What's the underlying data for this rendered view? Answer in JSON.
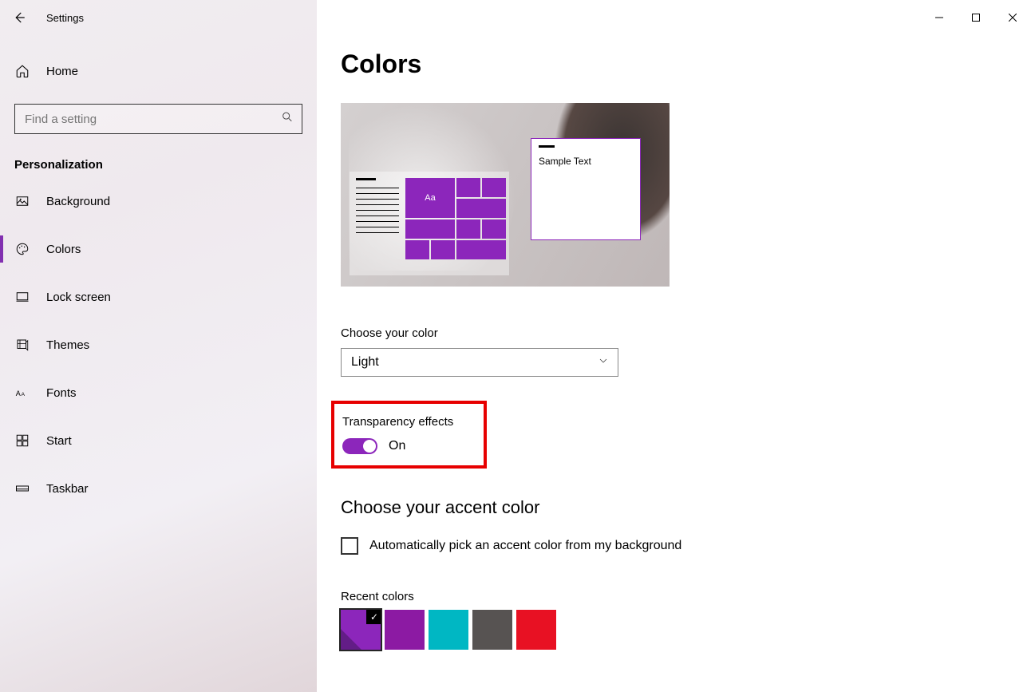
{
  "app": {
    "title": "Settings"
  },
  "sidebar": {
    "home": "Home",
    "search_placeholder": "Find a setting",
    "section": "Personalization",
    "items": [
      {
        "label": "Background"
      },
      {
        "label": "Colors"
      },
      {
        "label": "Lock screen"
      },
      {
        "label": "Themes"
      },
      {
        "label": "Fonts"
      },
      {
        "label": "Start"
      },
      {
        "label": "Taskbar"
      }
    ]
  },
  "main": {
    "title": "Colors",
    "preview": {
      "sample_text": "Sample Text",
      "tile_label": "Aa"
    },
    "choose_color": {
      "label": "Choose your color",
      "value": "Light"
    },
    "transparency": {
      "label": "Transparency effects",
      "state": "On"
    },
    "accent": {
      "heading": "Choose your accent color",
      "auto_label": "Automatically pick an accent color from my background",
      "recent_label": "Recent colors",
      "recent": [
        {
          "hex": "#8c26bb",
          "selected": true
        },
        {
          "hex": "#8c1aa3",
          "selected": false
        },
        {
          "hex": "#00b7c3",
          "selected": false
        },
        {
          "hex": "#575352",
          "selected": false
        },
        {
          "hex": "#e81123",
          "selected": false
        }
      ]
    }
  }
}
